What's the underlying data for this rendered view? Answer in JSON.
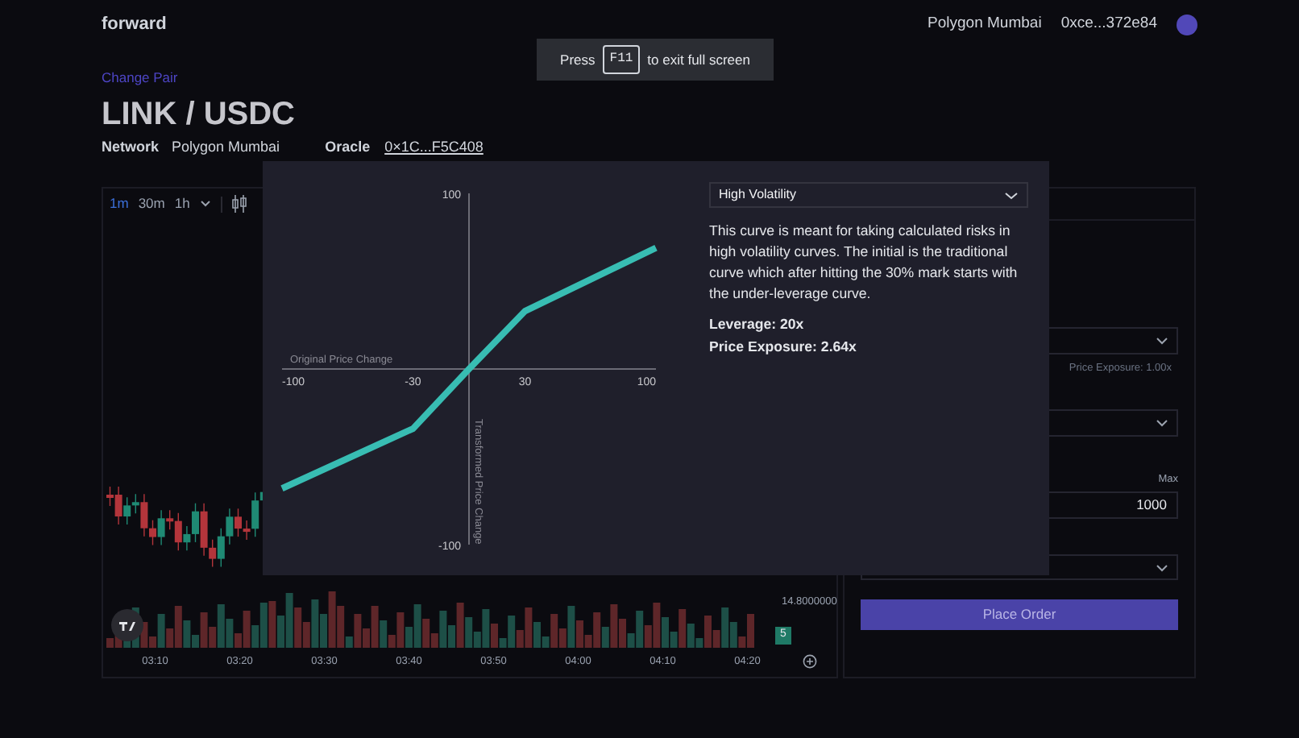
{
  "app": {
    "name": "forward"
  },
  "header": {
    "network": "Polygon Mumbai",
    "account": "0xce...372e84"
  },
  "fullscreen_notice": {
    "before": "Press",
    "key": "F11",
    "after": "to exit full screen"
  },
  "pair": {
    "change_link": "Change Pair",
    "title": "LINK / USDC",
    "network_label": "Network",
    "network": "Polygon Mumbai",
    "oracle_label": "Oracle",
    "oracle": "0×1C...F5C408"
  },
  "price_chart": {
    "intervals": [
      {
        "label": "1m",
        "selected": true
      },
      {
        "label": "30m",
        "selected": false
      },
      {
        "label": "1h",
        "selected": false
      }
    ],
    "price_label": "14.8000000",
    "badge": "5",
    "time_labels": [
      "03:10",
      "03:20",
      "03:30",
      "03:40",
      "03:50",
      "04:00",
      "04:10",
      "04:20"
    ]
  },
  "order_panel": {
    "exposure_note": "Price Exposure: 1.00x",
    "max_label": "Max",
    "amount": "1000",
    "submit": "Place Order"
  },
  "curve_modal": {
    "select": "High Volatility",
    "description": "This curve is meant for taking calculated risks in high volatility curves. The initial is the traditional curve which after hitting the 30% mark starts with the under-leverage curve.",
    "leverage": "Leverage: 20x",
    "exposure": "Price Exposure: 2.64x",
    "chart_data": {
      "type": "line",
      "xlabel": "Original Price Change",
      "ylabel": "Transformed Price Change",
      "x": [
        -100,
        -30,
        0,
        30,
        100
      ],
      "series": [
        {
          "color": "#38bdb3",
          "values": [
            -68,
            -34,
            0,
            33,
            69
          ]
        }
      ],
      "xlim": [
        -100,
        100
      ],
      "ylim": [
        -100,
        100
      ],
      "xticks": [
        -100,
        -30,
        30,
        100
      ],
      "yticks": [
        -100,
        100
      ]
    }
  }
}
